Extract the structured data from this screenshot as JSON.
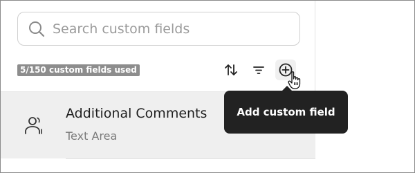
{
  "search": {
    "placeholder": "Search custom fields",
    "icon": "search-icon"
  },
  "usage": {
    "label": "5/150 custom fields used"
  },
  "toolbar": {
    "sort_icon": "sort-icon",
    "filter_icon": "filter-icon",
    "add_icon": "plus-circle-icon"
  },
  "fields": [
    {
      "name": "Additional Comments",
      "type": "Text Area",
      "icon": "users-icon"
    }
  ],
  "tooltip": {
    "text": "Add custom field"
  },
  "colors": {
    "badge_bg": "#8d8d8d",
    "tooltip_bg": "#222222",
    "row_bg": "#efefef"
  }
}
